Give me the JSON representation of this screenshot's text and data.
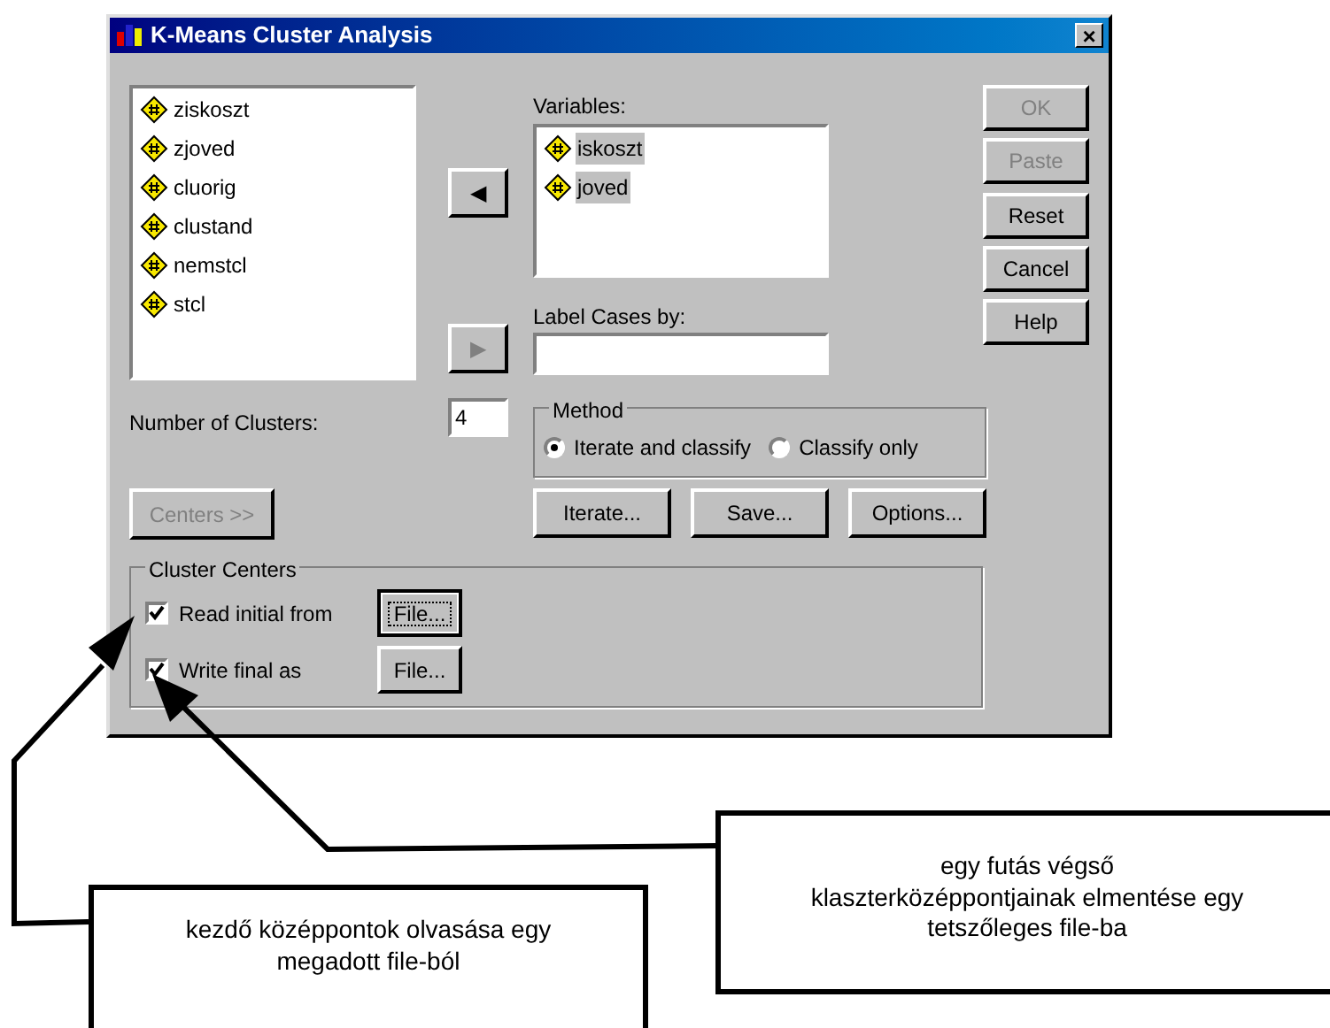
{
  "window": {
    "title": "K-Means Cluster Analysis",
    "close": "×"
  },
  "source_list": [
    {
      "label": "ziskoszt",
      "selected": false
    },
    {
      "label": "zjoved",
      "selected": false
    },
    {
      "label": "cluorig",
      "selected": false
    },
    {
      "label": "clustand",
      "selected": false
    },
    {
      "label": "nemstcl",
      "selected": false
    },
    {
      "label": "stcl",
      "selected": false
    }
  ],
  "move_buttons": [
    {
      "glyph": "◀",
      "disabled": false
    },
    {
      "glyph": "▶",
      "disabled": true
    }
  ],
  "variables": {
    "label": "Variables:",
    "items": [
      {
        "label": "iskoszt",
        "selected": true
      },
      {
        "label": "joved",
        "selected": true
      }
    ]
  },
  "label_cases": {
    "label": "Label Cases by:"
  },
  "side_buttons": [
    {
      "label": "OK",
      "disabled": true
    },
    {
      "label": "Paste",
      "disabled": true
    },
    {
      "label": "Reset",
      "disabled": false
    },
    {
      "label": "Cancel",
      "disabled": false
    },
    {
      "label": "Help",
      "disabled": false
    }
  ],
  "clusters": {
    "label": "Number of Clusters:",
    "value": "4"
  },
  "method": {
    "title": "Method",
    "options": [
      {
        "label": "Iterate and classify",
        "selected": true
      },
      {
        "label": "Classify only",
        "selected": false
      }
    ]
  },
  "centers_button": {
    "label": "Centers >>",
    "disabled": true
  },
  "action_buttons": [
    {
      "label": "Iterate..."
    },
    {
      "label": "Save..."
    },
    {
      "label": "Options..."
    }
  ],
  "cluster_centers": {
    "title": "Cluster Centers",
    "rows": [
      {
        "label": "Read initial from",
        "checked": true,
        "button": "File...",
        "focused": true
      },
      {
        "label": "Write final as",
        "checked": true,
        "button": "File...",
        "focused": false
      }
    ]
  },
  "callouts": [
    {
      "text": "kezdő középpontok olvasása egy megadott file-ból"
    },
    {
      "text": "egy futás végső\nklaszterközéppontjainak elmentése egy\ntetszőleges file-ba"
    }
  ]
}
